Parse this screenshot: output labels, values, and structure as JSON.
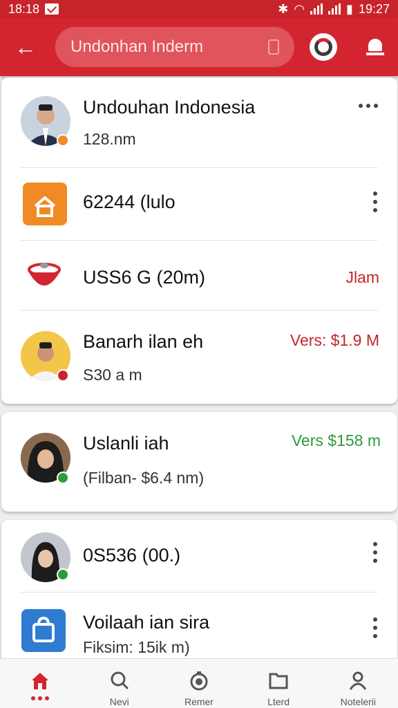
{
  "status_bar": {
    "time_left": "18:18",
    "time_right": "19:27"
  },
  "header": {
    "search_placeholder": "Undonhan Inderm"
  },
  "items": [
    {
      "title": "Undouhan Indonesia",
      "subtitle": "128.nm"
    },
    {
      "title": "62244 (lulo"
    },
    {
      "title": "USS6 G (20m)",
      "value": "Jlam"
    },
    {
      "title": "Banarh ilan eh",
      "subtitle": "S30 a m",
      "value": "Vers: $1.9 M"
    },
    {
      "title": "Uslanli iah",
      "subtitle": "(Filban- $6.4 nm)",
      "value": "Vers $158 m"
    },
    {
      "title": "0S536 (00.)"
    },
    {
      "title": "Voilaah ian sira",
      "subtitle": "Fiksim: 15ik m)"
    }
  ],
  "bottom_nav": [
    {
      "label": ""
    },
    {
      "label": "Nevi"
    },
    {
      "label": "Remer"
    },
    {
      "label": "Lterd"
    },
    {
      "label": "Notelerii"
    }
  ],
  "colors": {
    "brand_red": "#d32530",
    "value_red": "#c8242b",
    "value_green": "#2e9b3a",
    "orange": "#f08a24",
    "blue": "#2f7bd1"
  },
  "icons": [
    "arrow-left-icon",
    "mic-icon",
    "ring-icon",
    "bell-icon",
    "more-horizontal-icon",
    "more-vertical-icon",
    "home-icon",
    "search-icon",
    "timer-icon",
    "folder-icon",
    "person-icon"
  ]
}
